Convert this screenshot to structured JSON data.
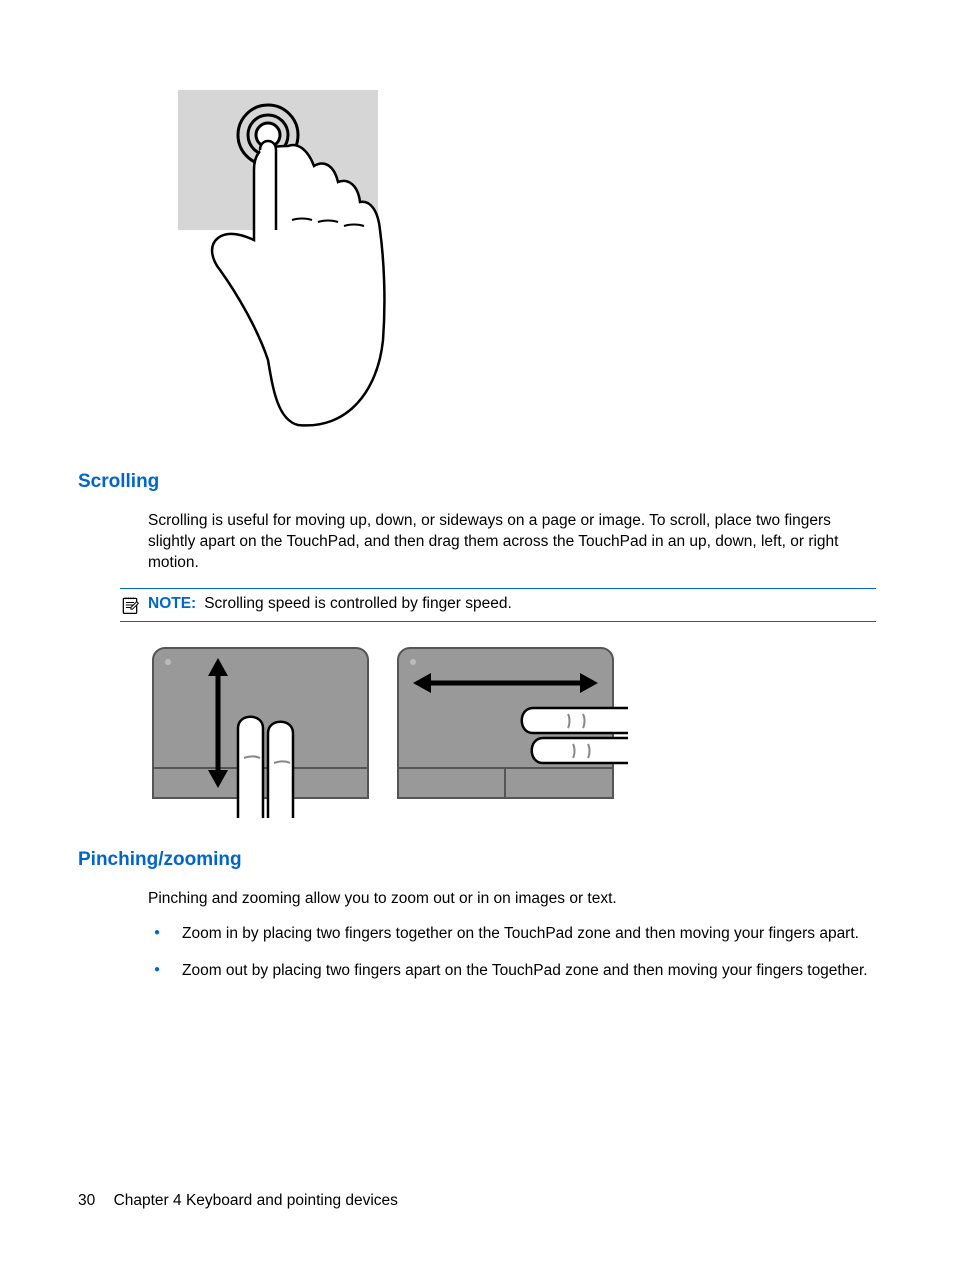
{
  "headings": {
    "scrolling": "Scrolling",
    "pinching": "Pinching/zooming"
  },
  "scrolling": {
    "para": "Scrolling is useful for moving up, down, or sideways on a page or image. To scroll, place two fingers slightly apart on the TouchPad, and then drag them across the TouchPad in an up, down, left, or right motion."
  },
  "note": {
    "label": "NOTE:",
    "text": "Scrolling speed is controlled by finger speed."
  },
  "pinching": {
    "para": "Pinching and zooming allow you to zoom out or in on images or text.",
    "bullets": [
      "Zoom in by placing two fingers together on the TouchPad zone and then moving your fingers apart.",
      "Zoom out by placing two fingers apart on the TouchPad zone and then moving your fingers together."
    ]
  },
  "footer": {
    "page_number": "30",
    "chapter": "Chapter 4   Keyboard and pointing devices"
  }
}
